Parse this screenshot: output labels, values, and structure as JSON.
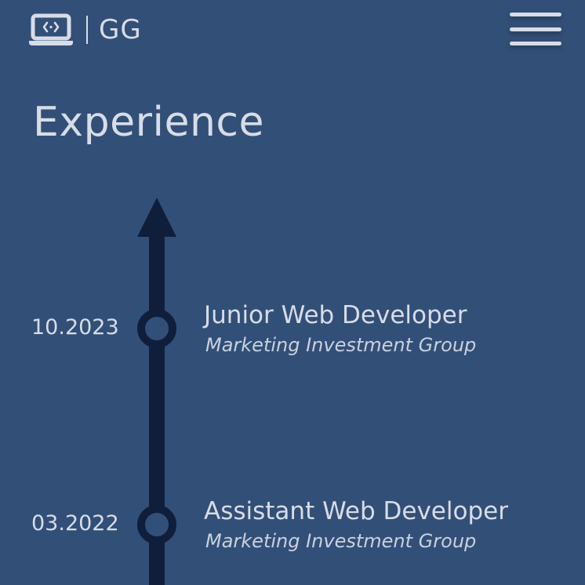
{
  "header": {
    "brand_icon": "laptop-code-icon",
    "brand_initials": "GG",
    "menu_icon": "hamburger-menu-icon"
  },
  "section": {
    "title": "Experience"
  },
  "timeline": {
    "arrow_icon": "arrow-up-icon",
    "entries": [
      {
        "date": "10.2023",
        "role": "Junior Web Developer",
        "company": "Marketing Investment Group"
      },
      {
        "date": "03.2022",
        "role": "Assistant Web Developer",
        "company": "Marketing Investment Group"
      }
    ]
  },
  "colors": {
    "background": "#324f78",
    "text": "#d7dde7",
    "timeline": "#0f1f3b"
  }
}
